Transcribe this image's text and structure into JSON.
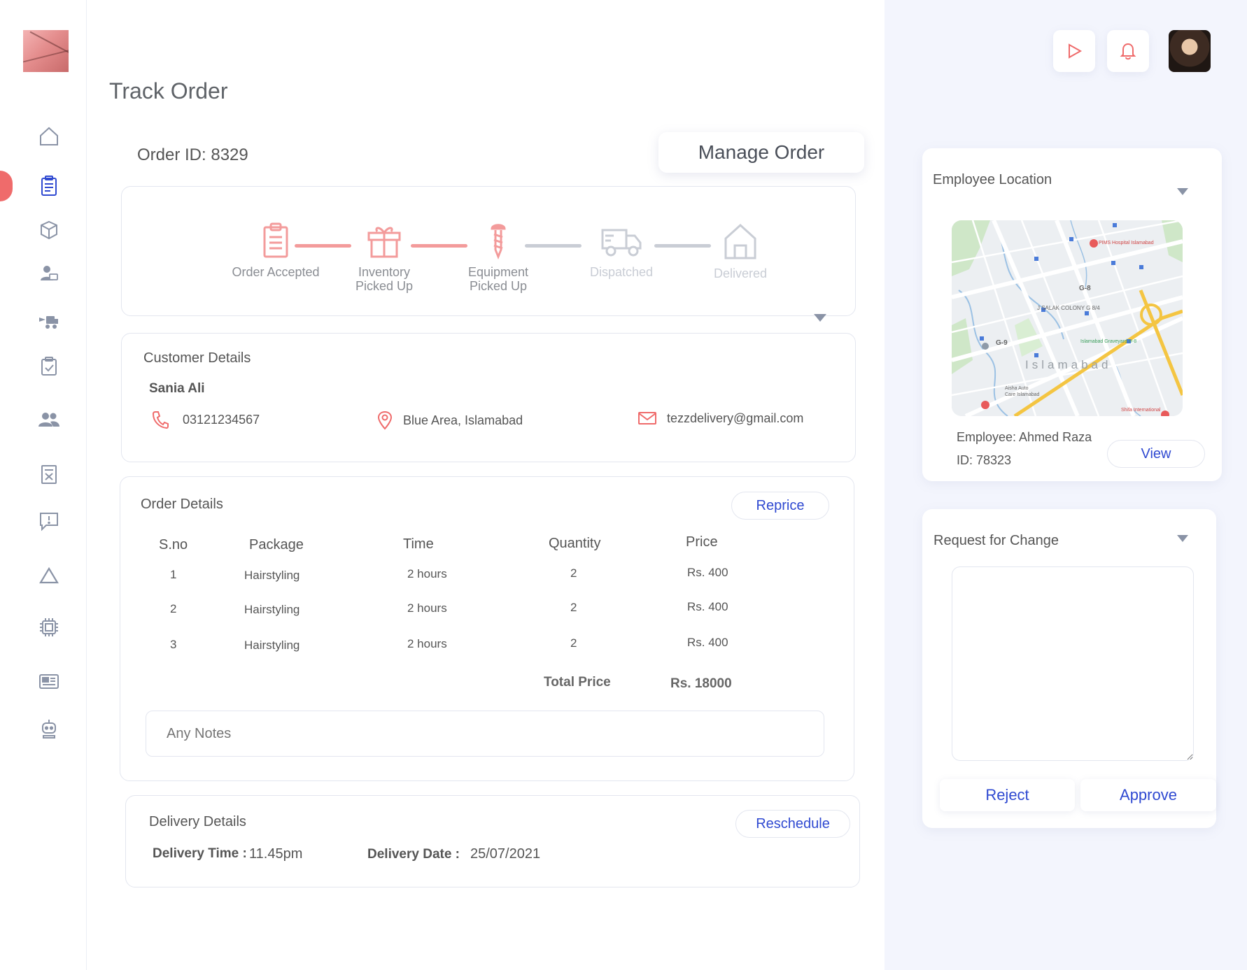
{
  "page": {
    "title": "Track Order"
  },
  "order": {
    "id_label": "Order ID: 8329",
    "manage_label": "Manage Order"
  },
  "tracker": {
    "steps": [
      {
        "label_line1": "Order Accepted",
        "label_line2": "",
        "state": "done",
        "icon": "clipboard-icon"
      },
      {
        "label_line1": "Inventory",
        "label_line2": "Picked Up",
        "state": "done",
        "icon": "gift-icon"
      },
      {
        "label_line1": "Equipment",
        "label_line2": "Picked Up",
        "state": "done",
        "icon": "screw-icon"
      },
      {
        "label_line1": "Dispatched",
        "label_line2": "",
        "state": "pending",
        "icon": "truck-icon"
      },
      {
        "label_line1": "Delivered",
        "label_line2": "",
        "state": "pending",
        "icon": "house-icon"
      }
    ]
  },
  "customer": {
    "title": "Customer Details",
    "name": "Sania Ali",
    "phone": "03121234567",
    "address": "Blue Area, Islamabad",
    "email": "tezzdelivery@gmail.com"
  },
  "order_details": {
    "title": "Order Details",
    "reprice_label": "Reprice",
    "headers": {
      "sno": "S.no",
      "package": "Package",
      "time": "Time",
      "quantity": "Quantity",
      "price": "Price"
    },
    "rows": [
      {
        "sno": "1",
        "package": "Hairstyling",
        "time": "2 hours",
        "quantity": "2",
        "price": "Rs. 400"
      },
      {
        "sno": "2",
        "package": "Hairstyling",
        "time": "2 hours",
        "quantity": "2",
        "price": "Rs. 400"
      },
      {
        "sno": "3",
        "package": "Hairstyling",
        "time": "2 hours",
        "quantity": "2",
        "price": "Rs. 400"
      }
    ],
    "total_label": "Total Price",
    "total_value": "Rs. 18000",
    "notes_placeholder": "Any Notes"
  },
  "delivery": {
    "title": "Delivery Details",
    "reschedule_label": "Reschedule",
    "time_label": "Delivery Time :",
    "time_value": "11.45pm",
    "date_label": "Delivery Date :",
    "date_value": "25/07/2021"
  },
  "employee": {
    "title": "Employee Location",
    "name_line": "Employee: Ahmed Raza",
    "id_line": "ID: 78323",
    "view_label": "View",
    "map": {
      "labels": [
        "Islamabad",
        "G-8",
        "G-9",
        "J SALAK COLONY G 8/4",
        "PIMS Hospital Islamabad",
        "Islamabad Graveyard H-8",
        "Shifa International",
        "Aisha Auto Care Islamabad"
      ]
    }
  },
  "request": {
    "title": "Request for Change",
    "reject_label": "Reject",
    "approve_label": "Approve"
  },
  "colors": {
    "accent_red": "#ef6b6b",
    "blue": "#2f49d1",
    "inactive": "#c9cdd5"
  }
}
